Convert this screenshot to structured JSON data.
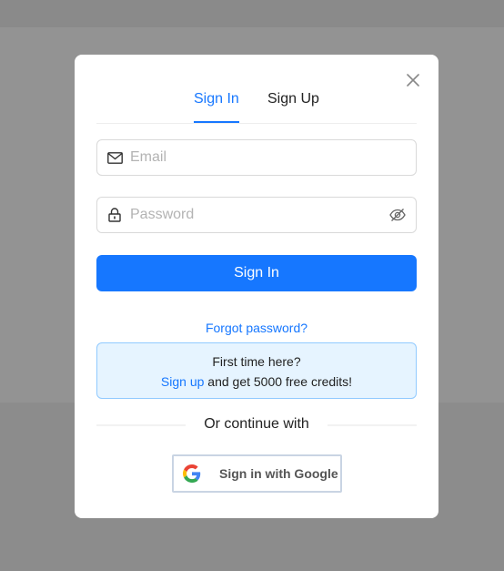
{
  "tabs": [
    {
      "label": "Sign In",
      "active": true
    },
    {
      "label": "Sign Up",
      "active": false
    }
  ],
  "email": {
    "placeholder": "Email",
    "value": "",
    "icon": "mail-icon"
  },
  "password": {
    "placeholder": "Password",
    "value": "",
    "icon": "lock-icon",
    "toggle_icon": "eye-off-icon"
  },
  "submit_label": "Sign In",
  "forgot_label": "Forgot password?",
  "info": {
    "line1": "First time here?",
    "link": "Sign up",
    "line2_rest": " and get 5000 free credits!"
  },
  "divider_text": "Or continue with",
  "google_label": "Sign in with Google",
  "colors": {
    "accent": "#1677ff",
    "info_bg": "#e6f4ff",
    "info_border": "#91caff"
  }
}
